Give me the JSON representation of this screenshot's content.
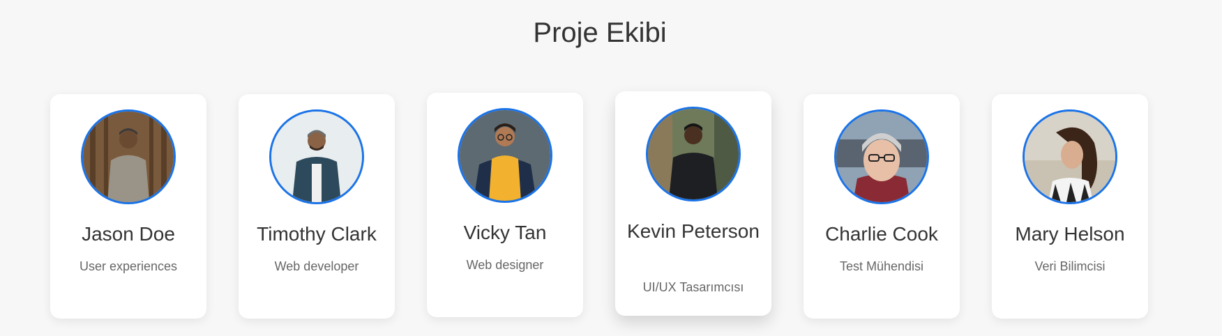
{
  "page": {
    "title": "Proje Ekibi"
  },
  "team": [
    {
      "name": "Jason Doe",
      "role": "User experiences",
      "avatar_icon": "person-photo-icon"
    },
    {
      "name": "Timothy Clark",
      "role": "Web developer",
      "avatar_icon": "person-photo-icon"
    },
    {
      "name": "Vicky Tan",
      "role": "Web designer",
      "avatar_icon": "person-photo-icon"
    },
    {
      "name": "Kevin Peterson",
      "role": "UI/UX Tasarımcısı",
      "avatar_icon": "person-photo-icon"
    },
    {
      "name": "Charlie Cook",
      "role": "Test Mühendisi",
      "avatar_icon": "person-photo-icon"
    },
    {
      "name": "Mary Helson",
      "role": "Veri Bilimcisi",
      "avatar_icon": "person-photo-icon"
    }
  ],
  "colors": {
    "background": "#f7f7f7",
    "card": "#ffffff",
    "avatar_border": "#1a73e8",
    "name_text": "#333333",
    "role_text": "#666666"
  }
}
